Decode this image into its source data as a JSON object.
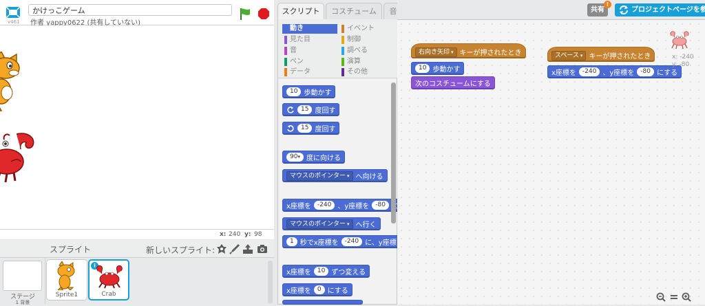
{
  "header": {
    "project_title": "かけっこゲーム",
    "author": "作者 yappy0622 (共有していない)",
    "version": "v461"
  },
  "stage": {
    "coords": {
      "x_label": "x:",
      "x_value": "240",
      "y_label": "y:",
      "y_value": "98"
    }
  },
  "sprites": {
    "title": "スプライト",
    "new_sprite_label": "新しいスプライト:",
    "stage_label": "ステージ",
    "stage_sub": "1 背景",
    "items": [
      {
        "name": "Sprite1"
      },
      {
        "name": "Crab"
      }
    ],
    "info_badge": "i"
  },
  "tabs": [
    {
      "label": "スクリプト"
    },
    {
      "label": "コスチューム"
    },
    {
      "label": "音"
    }
  ],
  "categories": [
    {
      "label": "動き",
      "color": "#4a6cd4"
    },
    {
      "label": "見た目",
      "color": "#8a55d7"
    },
    {
      "label": "音",
      "color": "#bb42c3"
    },
    {
      "label": "ペン",
      "color": "#0e9a6c"
    },
    {
      "label": "データ",
      "color": "#ee7d16"
    },
    {
      "label": "イベント",
      "color": "#c88330"
    },
    {
      "label": "制御",
      "color": "#e1a91a"
    },
    {
      "label": "調べる",
      "color": "#2ca5e2"
    },
    {
      "label": "演算",
      "color": "#5cb712"
    },
    {
      "label": "その他",
      "color": "#632d99"
    }
  ],
  "palette": {
    "move": {
      "value": "10",
      "text": "歩動かす"
    },
    "turn_right": {
      "value": "15",
      "text": "度回す"
    },
    "turn_left": {
      "value": "15",
      "text": "度回す"
    },
    "point_dir": {
      "value": "90",
      "text": "度に向ける"
    },
    "point_towards": {
      "option": "マウスのポインター",
      "text": "へ向ける"
    },
    "goto_xy": {
      "a": "x座標を",
      "x": "-240",
      "b": "、y座標を",
      "y": "-80",
      "c": "に"
    },
    "goto": {
      "option": "マウスのポインター",
      "text": "へ行く"
    },
    "glide": {
      "secs": "1",
      "a": "秒でx座標を",
      "x": "-240",
      "b": "に、y座標を"
    },
    "change_x": {
      "a": "x座標を",
      "value": "10",
      "b": "ずつ変える"
    },
    "set_x": {
      "a": "x座標を",
      "value": "0",
      "b": "にする"
    }
  },
  "scripts": {
    "script1": {
      "hat_key": "右向き矢印",
      "hat_text": "キーが押されたとき",
      "move_value": "10",
      "move_text": "歩動かす",
      "costume_text": "次のコスチュームにする"
    },
    "script2": {
      "hat_key": "スペース",
      "hat_text": "キーが押されたとき",
      "goto_a": "x座標を",
      "goto_x": "-240",
      "goto_b": "、y座標を",
      "goto_y": "-80",
      "goto_c": "にする"
    },
    "sprite_x": "x: -240",
    "sprite_y": "y: -80"
  },
  "topbar": {
    "share_label": "共有",
    "share_badge": "!",
    "project_page_label": "プロジェクトページを参照"
  }
}
